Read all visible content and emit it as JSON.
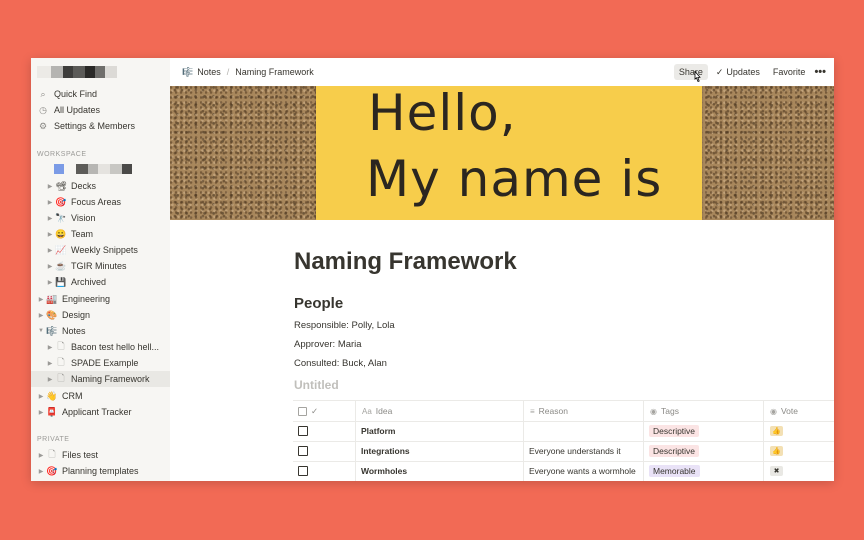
{
  "sidebar": {
    "top_items": [
      {
        "label": "Quick Find",
        "icon": "search-icon",
        "glyph": "⌕"
      },
      {
        "label": "All Updates",
        "icon": "clock-icon",
        "glyph": "◷"
      },
      {
        "label": "Settings & Members",
        "icon": "gear-icon",
        "glyph": "⚙"
      }
    ],
    "workspace_label": "WORKSPACE",
    "private_label": "PRIVATE",
    "items": [
      {
        "label": "Decks",
        "emoji": "📽"
      },
      {
        "label": "Focus Areas",
        "emoji": "🎯"
      },
      {
        "label": "Vision",
        "emoji": "🔭"
      },
      {
        "label": "Team",
        "emoji": "😀"
      },
      {
        "label": "Weekly Snippets",
        "emoji": "📈"
      },
      {
        "label": "TGIR Minutes",
        "emoji": "☕"
      },
      {
        "label": "Archived",
        "emoji": "💾"
      },
      {
        "label": "Engineering",
        "emoji": "🏭"
      },
      {
        "label": "Design",
        "emoji": "🎨"
      },
      {
        "label": "Notes",
        "emoji": "🎼"
      },
      {
        "label": "Bacon test hello hell...",
        "emoji": "🗋"
      },
      {
        "label": "SPADE Example",
        "emoji": "🗋"
      },
      {
        "label": "Naming Framework",
        "emoji": "🗋"
      },
      {
        "label": "CRM",
        "emoji": "👋"
      },
      {
        "label": "Applicant Tracker",
        "emoji": "📮"
      }
    ],
    "private_items": [
      {
        "label": "Files test",
        "emoji": "🗋"
      },
      {
        "label": "Planning templates",
        "emoji": "🎯"
      }
    ]
  },
  "topbar": {
    "breadcrumb": [
      {
        "label": "Notes",
        "emoji": "🎼"
      },
      {
        "label": "Naming Framework"
      }
    ],
    "share": "Share",
    "updates": "Updates",
    "favorite": "Favorite",
    "more": "•••"
  },
  "cover": {
    "line1": "Hello,",
    "line2": "My name is"
  },
  "page": {
    "title": "Naming Framework",
    "heading": "People",
    "responsible": "Responsible: Polly, Lola",
    "approver": "Approver: Maria",
    "consulted": "Consulted: Buck, Alan",
    "db_title": "Untitled"
  },
  "table": {
    "headers": {
      "check": "✓",
      "idea": "Idea",
      "reason": "Reason",
      "tags": "Tags",
      "vote": "Vote"
    },
    "rows": [
      {
        "idea": "Platform",
        "reason": "",
        "tag": "Descriptive",
        "vote": "👍"
      },
      {
        "idea": "Integrations",
        "reason": "Everyone understands it",
        "tag": "Descriptive",
        "vote": "👍"
      },
      {
        "idea": "Wormholes",
        "reason": "Everyone wants a wormhole",
        "tag": "Memorable",
        "vote": "✖"
      }
    ]
  },
  "colors": {
    "background": "#f26a55",
    "sidebar": "#f7f6f3",
    "sticky_note": "#f7cd4b",
    "tag_descriptive": "#fbe4e4",
    "tag_memorable": "#e9e2f7"
  }
}
